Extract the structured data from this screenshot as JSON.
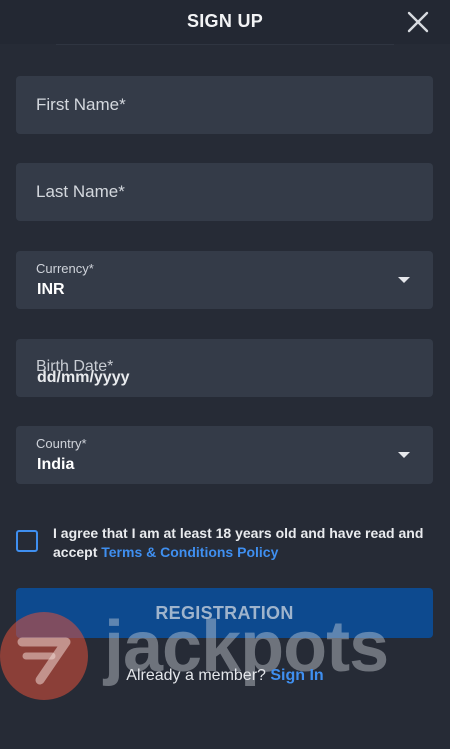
{
  "header": {
    "title": "SIGN UP"
  },
  "form": {
    "first_name": {
      "placeholder": "First Name*"
    },
    "last_name": {
      "placeholder": "Last Name*"
    },
    "currency": {
      "label": "Currency*",
      "value": "INR"
    },
    "birth_date": {
      "label": "Birth Date*",
      "placeholder": "dd/mm/yyyy"
    },
    "country": {
      "label": "Country*",
      "value": "India"
    }
  },
  "agreement": {
    "text": "I agree that I am at least 18 years old and have read and accept ",
    "link": "Terms & Conditions Policy"
  },
  "registration_button": "REGISTRATION",
  "footer": {
    "question": "Already a member? ",
    "link": "Sign In"
  },
  "watermark": {
    "text": "jackpots"
  },
  "colors": {
    "background": "#262b36",
    "field": "#343b48",
    "accent": "#3f8ff0",
    "button": "#0d4a8f"
  }
}
